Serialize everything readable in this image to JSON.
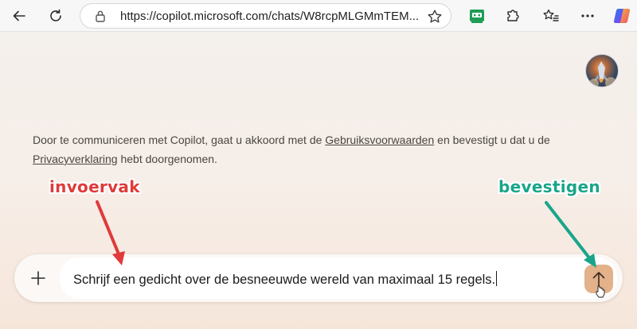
{
  "browser": {
    "url": "https://copilot.microsoft.com/chats/W8rcpMLGMmTEM..."
  },
  "terms": {
    "prefix": "Door te communiceren met Copilot, gaat u akkoord met de ",
    "link_terms": "Gebruiksvoorwaarden",
    "middle": " en bevestigt u dat u de ",
    "link_privacy": "Privacyverklaring",
    "suffix": " hebt doorgenomen."
  },
  "annotations": {
    "input_label": "invoervak",
    "submit_label": "bevestigen",
    "input_color": "#e03a3a",
    "submit_color": "#1aa58a"
  },
  "composer": {
    "value": "Schrijf een gedicht over de besneeuwde wereld van maximaal 15 regels."
  },
  "icons": {
    "back": "back-arrow-icon",
    "refresh": "refresh-icon",
    "lock": "lock-icon",
    "favorite": "star-icon",
    "extension_1": "robot-extension-icon",
    "extension_2": "puzzle-icon",
    "favorites": "favorites-icon",
    "more": "more-icon",
    "copilot": "copilot-icon",
    "plus": "plus-icon",
    "send": "send-arrow-icon"
  }
}
